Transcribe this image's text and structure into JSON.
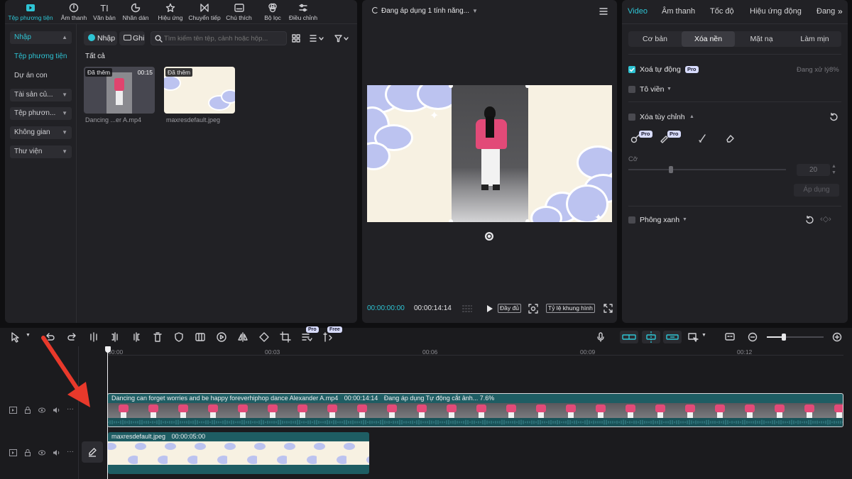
{
  "top_tabs": [
    {
      "label": "Tệp phương tiện",
      "icon": "media-icon",
      "active": true
    },
    {
      "label": "Âm thanh",
      "icon": "audio-icon"
    },
    {
      "label": "Văn bản",
      "icon": "text-icon"
    },
    {
      "label": "Nhãn dán",
      "icon": "sticker-icon"
    },
    {
      "label": "Hiệu ứng",
      "icon": "effects-icon"
    },
    {
      "label": "Chuyển tiếp",
      "icon": "transition-icon"
    },
    {
      "label": "Chú thích",
      "icon": "caption-icon"
    },
    {
      "label": "Bộ lọc",
      "icon": "filter-icon"
    },
    {
      "label": "Điều chỉnh",
      "icon": "adjust-icon"
    }
  ],
  "sidebar": {
    "items": [
      {
        "label": "Nhập"
      },
      {
        "label": "Tệp phương tiện"
      },
      {
        "label": "Dự án con"
      },
      {
        "label": "Tài sản củ..."
      },
      {
        "label": "Tệp phươn..."
      },
      {
        "label": "Không gian"
      },
      {
        "label": "Thư viện"
      }
    ]
  },
  "media": {
    "import_label": "Nhập",
    "record_label": "Ghi",
    "search_placeholder": "Tìm kiếm tên tệp, cảnh hoặc hộp...",
    "section_title": "Tất cả",
    "items": [
      {
        "tag": "Đã thêm",
        "duration": "00:15",
        "name": "Dancing ...er A.mp4"
      },
      {
        "tag": "Đã thêm",
        "duration": "",
        "name": "maxresdefault.jpeg"
      }
    ]
  },
  "player": {
    "status": "Đang áp dụng 1 tính năng...",
    "current_time": "00:00:00:00",
    "total_time": "00:00:14:14",
    "full_label": "Đầy đủ",
    "ratio_label": "Tỷ lệ khung hình"
  },
  "inspector": {
    "tabs": [
      "Video",
      "Âm thanh",
      "Tốc độ",
      "Hiệu ứng động",
      "Đang"
    ],
    "segments": [
      "Cơ bản",
      "Xóa nền",
      "Mặt nạ",
      "Làm mịn"
    ],
    "auto_remove": {
      "label": "Xoá tự động",
      "badge": "Pro",
      "status": "Đang xử lý8%"
    },
    "outline": {
      "label": "Tô viền"
    },
    "custom_remove": {
      "label": "Xóa tùy chỉnh",
      "badge1": "Pro",
      "badge2": "Pro"
    },
    "size": {
      "label": "Cỡ",
      "value": "20",
      "fraction": 0.27
    },
    "apply_label": "Áp dụng",
    "green_screen": {
      "label": "Phông xanh"
    }
  },
  "toolbar": {
    "badge_pro": "Pro",
    "badge_free": "Free"
  },
  "timeline": {
    "ruler": [
      "00:00",
      "00:03",
      "00:06",
      "00:09",
      "00:12"
    ],
    "playhead_fraction": 0.0,
    "zoom_fraction": 0.3,
    "video_clip": {
      "name": "Dancing can forget worries and be happy foreverhiphop dance Alexander A.mp4",
      "duration": "00:00:14:14",
      "status": "Đang áp dụng Tự động cắt ảnh... 7.6%"
    },
    "image_clip": {
      "name": "maxresdefault.jpeg",
      "duration": "00:00:05:00"
    }
  },
  "colors": {
    "accent": "#2ec4d4",
    "clip_teal": "#1e5d63",
    "arrow": "#e8392b"
  }
}
